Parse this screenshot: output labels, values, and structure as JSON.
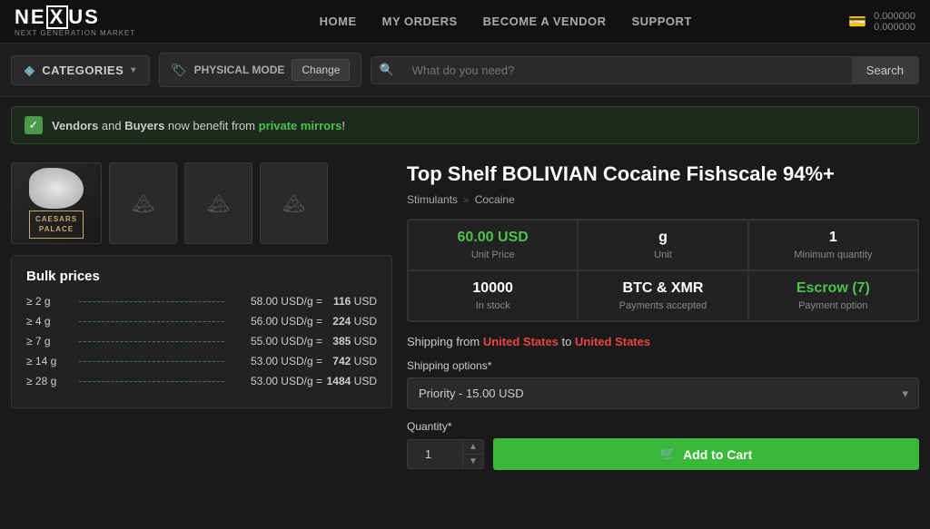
{
  "header": {
    "logo_main": "NEXUS",
    "logo_sub": "NEXT GENERATION MARKET",
    "nav": {
      "home": "HOME",
      "my_orders": "MY ORDERS",
      "become_vendor": "BECOME A VENDOR",
      "support": "SUPPORT"
    },
    "wallet_line1": "0.000000",
    "wallet_line2": "0.000000"
  },
  "toolbar": {
    "categories_label": "CATEGORIES",
    "physical_mode_label": "PHYSICAL MODE",
    "change_btn": "Change",
    "search_placeholder": "What do you need?",
    "search_btn": "Search"
  },
  "banner": {
    "text_prefix": "",
    "vendors": "Vendors",
    "and": " and ",
    "buyers": "Buyers",
    "text_mid": " now benefit from ",
    "mirrors": "private mirrors",
    "text_suffix": "!"
  },
  "product": {
    "title": "Top Shelf BOLIVIAN Cocaine Fishscale 94%+",
    "breadcrumb1": "Stimulants",
    "breadcrumb2": "Cocaine",
    "unit_price_value": "60.00 USD",
    "unit_price_label": "Unit Price",
    "unit_value": "g",
    "unit_label": "Unit",
    "min_qty_value": "1",
    "min_qty_label": "Minimum quantity",
    "in_stock_value": "10000",
    "in_stock_label": "In stock",
    "payments_value": "BTC & XMR",
    "payments_label": "Payments accepted",
    "escrow_value": "Escrow (7)",
    "escrow_label": "Payment option",
    "shipping_label": "Shipping from",
    "shipping_from": "United States",
    "shipping_to": "United States",
    "shipping_options_label": "Shipping options*",
    "shipping_option_selected": "Priority - 15.00 USD",
    "quantity_label": "Quantity*",
    "quantity_value": "1",
    "add_to_cart_btn": "Add to Cart"
  },
  "bulk_prices": {
    "title": "Bulk prices",
    "rows": [
      {
        "qty": "≥ 2 g",
        "price": "58.00 USD/g",
        "equals": "=",
        "total": "116",
        "unit": "USD"
      },
      {
        "qty": "≥ 4 g",
        "price": "56.00 USD/g",
        "equals": "=",
        "total": "224",
        "unit": "USD"
      },
      {
        "qty": "≥ 7 g",
        "price": "55.00 USD/g",
        "equals": "=",
        "total": "385",
        "unit": "USD"
      },
      {
        "qty": "≥ 14 g",
        "price": "53.00 USD/g",
        "equals": "=",
        "total": "742",
        "unit": "USD"
      },
      {
        "qty": "≥ 28 g",
        "price": "53.00 USD/g",
        "equals": "=",
        "total": "1484",
        "unit": "USD"
      }
    ]
  }
}
